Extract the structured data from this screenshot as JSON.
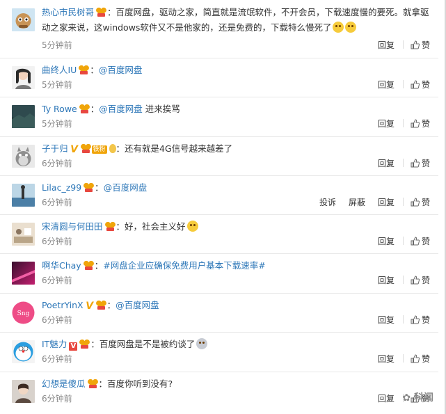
{
  "comments": [
    {
      "username": "热心市民树哥",
      "colon": "：",
      "text_main": "百度网盘，驱动之家，简直就是流氓软件，不开会员，下载速度慢的要死。就拿驱动之家来说，这windows软件又不是他家的，还是免费的，下载特么慢死了",
      "time": "5分钟前",
      "reply": "回复",
      "like": "赞"
    },
    {
      "username": "曲终人IU",
      "colon": "：",
      "mention": "@百度网盘",
      "time": "5分钟前",
      "reply": "回复",
      "like": "赞"
    },
    {
      "username": "Ty Rowe",
      "colon": "：",
      "mention": "@百度网盘",
      "text_main": " 进来挨骂",
      "time": "5分钟前",
      "reply": "回复",
      "like": "赞"
    },
    {
      "username": "子于归",
      "fans_label": "铁粉",
      "colon": "：",
      "text_main": "还有就是4G信号越来越差了",
      "time": "6分钟前",
      "reply": "回复",
      "like": "赞"
    },
    {
      "username": "Lilac_z99",
      "colon": "：",
      "mention": "@百度网盘",
      "time": "6分钟前",
      "report": "投诉",
      "block": "屏蔽",
      "reply": "回复",
      "like": "赞"
    },
    {
      "username": "宋清圆与何田田",
      "colon": "：",
      "text_main": "好，社会主义好",
      "time": "6分钟前",
      "reply": "回复",
      "like": "赞"
    },
    {
      "username": "啊华Chay",
      "colon": "：",
      "topic": "#网盘企业应确保免费用户基本下载速率#",
      "time": "6分钟前",
      "reply": "回复",
      "like": "赞"
    },
    {
      "username": "PoetrYinX",
      "colon": "：",
      "mention": "@百度网盘",
      "time": "6分钟前",
      "reply": "回复",
      "like": "赞"
    },
    {
      "username": "IT魅力",
      "colon": "：",
      "text_main": "百度网盘是不是被约谈了",
      "time": "6分钟前",
      "reply": "回复",
      "like": "赞"
    },
    {
      "username": "幻想是傻瓜",
      "colon": "：",
      "text_main": "百度你听到没有?",
      "time": "6分钟前",
      "reply": "回复",
      "like": "赞"
    }
  ],
  "watermark": "科闻",
  "colors": {
    "username": "#2d77b8",
    "badge_orange": "#f0a50a",
    "badge_red": "#e8483f"
  }
}
